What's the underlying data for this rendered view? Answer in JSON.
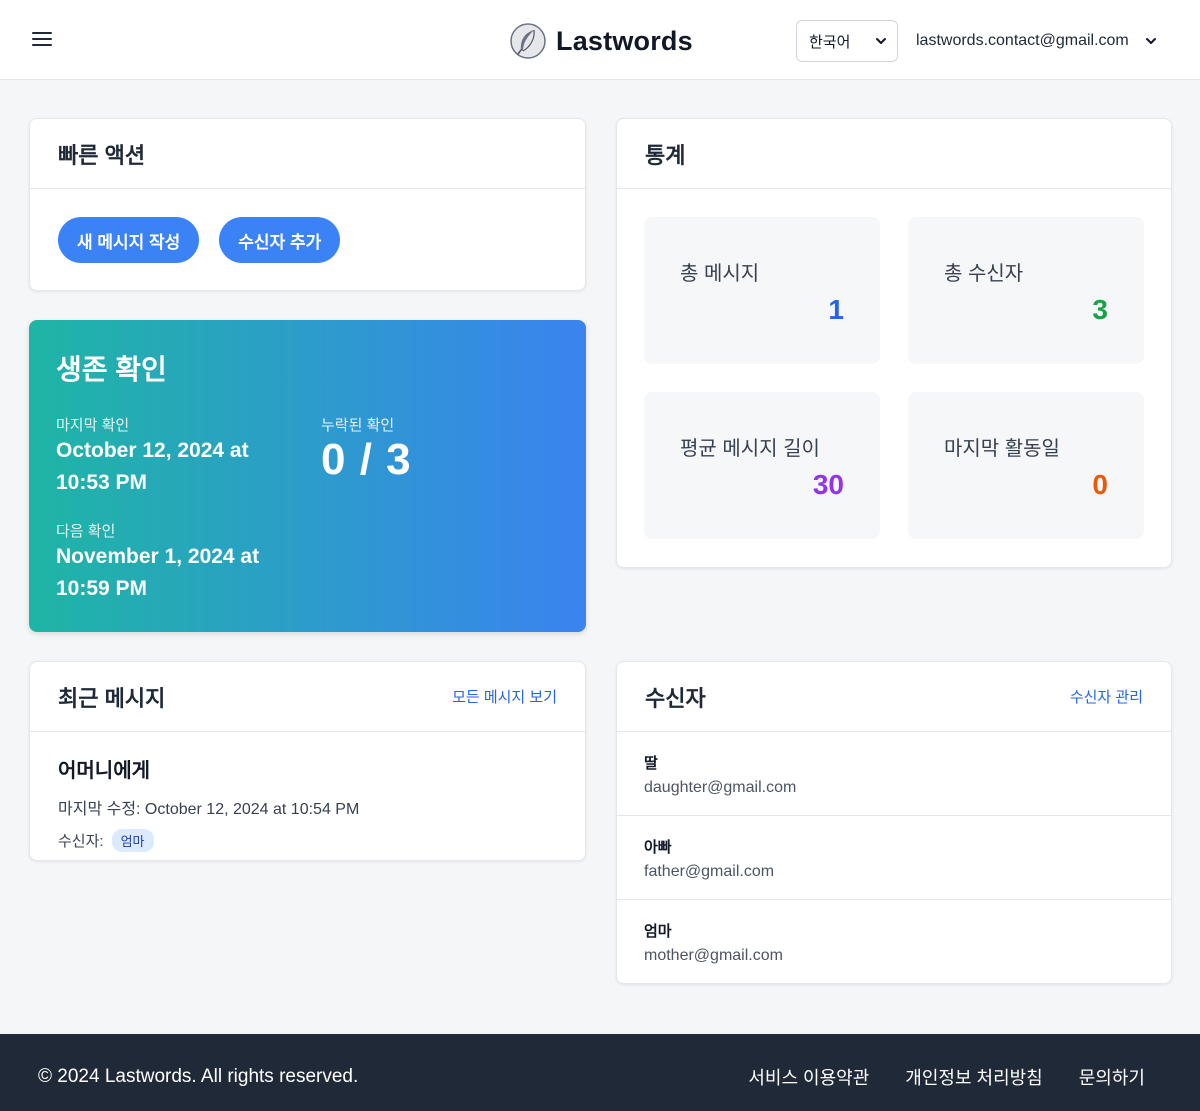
{
  "header": {
    "brand": "Lastwords",
    "language": "한국어",
    "user_email": "lastwords.contact@gmail.com"
  },
  "quick_actions": {
    "title": "빠른 액션",
    "new_message": "새 메시지 작성",
    "add_recipient": "수신자 추가"
  },
  "survival": {
    "title": "생존 확인",
    "last_check_label": "마지막 확인",
    "last_check_value": "October 12, 2024 at 10:53 PM",
    "missed_label": "누락된 확인",
    "missed_value": "0 / 3",
    "next_check_label": "다음 확인",
    "next_check_value": "November 1, 2024 at 10:59 PM"
  },
  "stats": {
    "title": "통계",
    "items": [
      {
        "label": "총 메시지",
        "value": "1",
        "color": "#2563eb"
      },
      {
        "label": "총 수신자",
        "value": "3",
        "color": "#16a34a"
      },
      {
        "label": "평균 메시지 길이",
        "value": "30",
        "color": "#9333ea"
      },
      {
        "label": "마지막 활동일",
        "value": "0",
        "color": "#ea580c"
      }
    ]
  },
  "recent": {
    "title": "최근 메시지",
    "view_all": "모든 메시지 보기",
    "message": {
      "title": "어머니에게",
      "modified": "마지막 수정: October 12, 2024 at 10:54 PM",
      "recipient_label": "수신자:",
      "recipient_tag": "엄마"
    }
  },
  "recipients": {
    "title": "수신자",
    "manage": "수신자 관리",
    "items": [
      {
        "name": "딸",
        "email": "daughter@gmail.com"
      },
      {
        "name": "아빠",
        "email": "father@gmail.com"
      },
      {
        "name": "엄마",
        "email": "mother@gmail.com"
      }
    ]
  },
  "footer": {
    "copyright": "© 2024 Lastwords. All rights reserved.",
    "terms": "서비스 이용약관",
    "privacy": "개인정보 처리방침",
    "contact": "문의하기"
  }
}
